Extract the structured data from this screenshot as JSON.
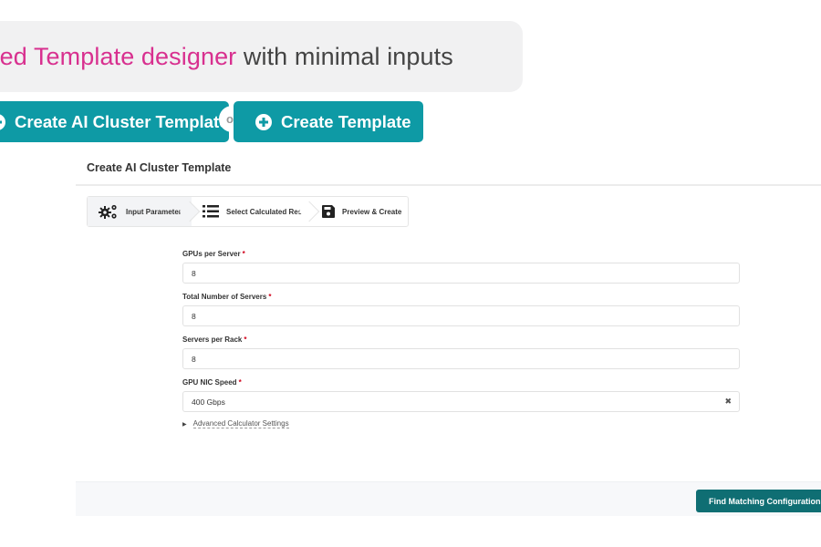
{
  "banner": {
    "highlight": "mplified Template designer",
    "rest": " with minimal inputs"
  },
  "actions": {
    "create_ai_label": "Create AI Cluster Template",
    "or_label": "or",
    "create_template_label": "Create Template"
  },
  "panel": {
    "title": "Create AI Cluster Template",
    "steps": [
      {
        "label": "Input Parameters",
        "icon": "gears-icon",
        "active": true
      },
      {
        "label": "Select Calculated Result",
        "icon": "list-icon",
        "active": false
      },
      {
        "label": "Preview & Create",
        "icon": "floppy-disk-icon",
        "active": false
      }
    ],
    "fields": [
      {
        "label": "GPUs per Server",
        "required": "*",
        "value": "8"
      },
      {
        "label": "Total Number of Servers",
        "required": "*",
        "value": "8"
      },
      {
        "label": "Servers per Rack",
        "required": "*",
        "value": "8"
      },
      {
        "label": "GPU NIC Speed",
        "required": "*",
        "value": "400 Gbps",
        "clear_icon": "✖"
      }
    ],
    "advanced_label": "Advanced Calculator Settings",
    "advanced_icon": "▶"
  },
  "footer": {
    "submit_label": "Find Matching Configurations"
  },
  "colors": {
    "accent_teal": "#0e9aa5",
    "submit_teal": "#0f6e73",
    "highlight_pink": "#d8308f",
    "required_red": "#d0021b"
  }
}
